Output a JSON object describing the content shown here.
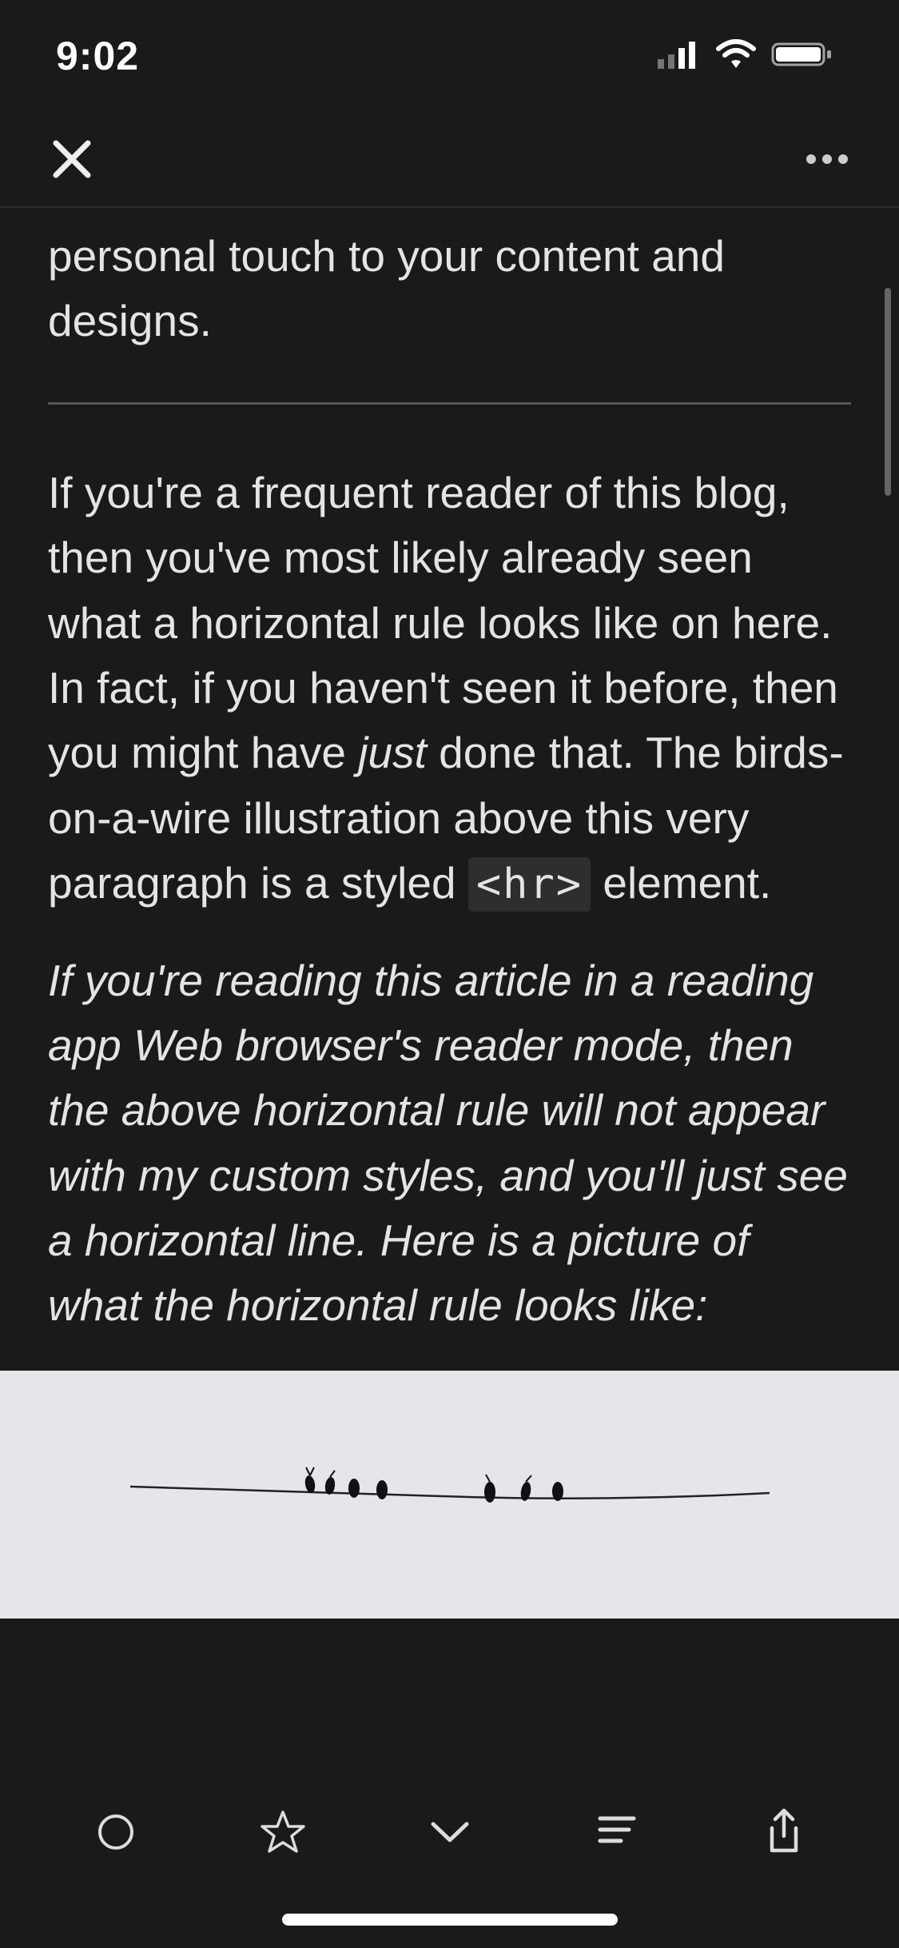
{
  "status": {
    "time": "9:02"
  },
  "article": {
    "p1_fragment": "personal touch to your content and designs.",
    "p2_part1": "If you're a frequent reader of this blog, then you've most likely already seen what a horizontal rule looks like on here. In fact, if you haven't seen it before, then you might have ",
    "p2_just": "just",
    "p2_part2": " done that. The birds-on-a-wire illustration above this very paragraph is a styled ",
    "p2_code": "<hr>",
    "p2_part3": " element.",
    "p3_italic": "If you're reading this article in a reading app Web browser's reader mode, then the above horizontal rule will not appear with my custom styles, and you'll just see a horizontal line. Here is a picture of what the horizontal rule looks like:"
  }
}
